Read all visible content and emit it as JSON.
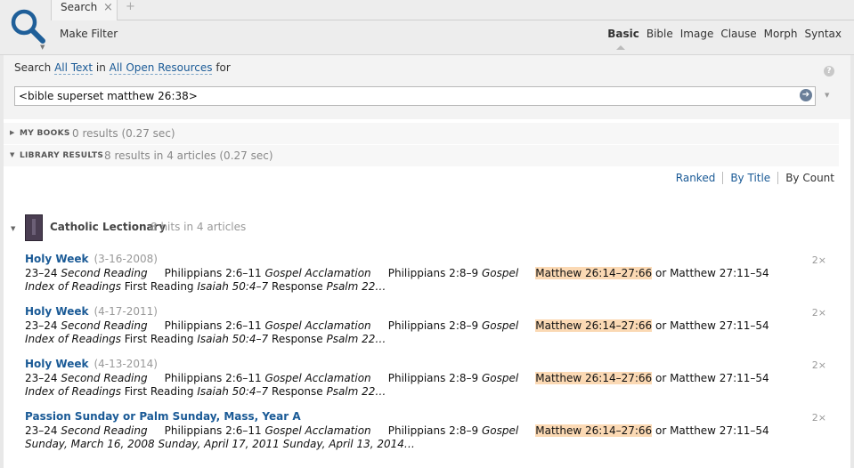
{
  "tab": {
    "label": "Search",
    "close": "×",
    "add": "+"
  },
  "toolbar": {
    "make_filter": "Make Filter"
  },
  "modes": [
    "Basic",
    "Bible",
    "Image",
    "Clause",
    "Morph",
    "Syntax"
  ],
  "search": {
    "prefix": "Search",
    "scope": "All Text",
    "in": "in",
    "resources": "All Open Resources",
    "for": "for",
    "query": "<bible superset matthew 26:38>"
  },
  "groups": [
    {
      "name": "MY BOOKS",
      "count": "0 results (0.27 sec)"
    },
    {
      "name": "LIBRARY RESULTS",
      "count": "8 results in 4 articles (0.27 sec)"
    }
  ],
  "sort": {
    "ranked": "Ranked",
    "by_title": "By Title",
    "by_count": "By Count"
  },
  "resource": {
    "title": "Catholic Lectionary",
    "hits": "8 hits in 4 articles"
  },
  "hits": [
    {
      "title": "Holy Week",
      "date": "(3-16-2008)",
      "count": "2×",
      "pre": "23–24 ",
      "sr": "Second Reading",
      "a": "     Philippians 2:6–11 ",
      "ga": "Gospel Acclamation",
      "b": "     Philippians 2:8–9 ",
      "g": "Gospel",
      "c": "     ",
      "hl": "Matthew 26:14–27:66",
      "d": " or Matthew 27:11–54 ",
      "tail_i": "Index of Readings",
      "tail": " First Reading ",
      "tail2_i": "Isaiah 50:4–7",
      "tail3": " Response ",
      "tail4_i": "Psalm 22…"
    },
    {
      "title": "Holy Week",
      "date": "(4-17-2011)",
      "count": "2×",
      "pre": "23–24 ",
      "sr": "Second Reading",
      "a": "     Philippians 2:6–11 ",
      "ga": "Gospel Acclamation",
      "b": "     Philippians 2:8–9 ",
      "g": "Gospel",
      "c": "     ",
      "hl": "Matthew 26:14–27:66",
      "d": " or Matthew 27:11–54 ",
      "tail_i": "Index of Readings",
      "tail": " First Reading ",
      "tail2_i": "Isaiah 50:4–7",
      "tail3": " Response ",
      "tail4_i": "Psalm 22…"
    },
    {
      "title": "Holy Week",
      "date": "(4-13-2014)",
      "count": "2×",
      "pre": "23–24 ",
      "sr": "Second Reading",
      "a": "     Philippians 2:6–11 ",
      "ga": "Gospel Acclamation",
      "b": "     Philippians 2:8–9 ",
      "g": "Gospel",
      "c": "     ",
      "hl": "Matthew 26:14–27:66",
      "d": " or Matthew 27:11–54 ",
      "tail_i": "Index of Readings",
      "tail": " First Reading ",
      "tail2_i": "Isaiah 50:4–7",
      "tail3": " Response ",
      "tail4_i": "Psalm 22…"
    },
    {
      "title": "Passion Sunday or Palm Sunday, Mass, Year A",
      "date": "",
      "count": "2×",
      "pre": "23–24 ",
      "sr": "Second Reading",
      "a": "     Philippians 2:6–11 ",
      "ga": "Gospel Acclamation",
      "b": "     Philippians 2:8–9 ",
      "g": "Gospel",
      "c": "     ",
      "hl": "Matthew 26:14–27:66",
      "d": " or Matthew 27:11–54 ",
      "tail_i": "Sunday, March 16, 2008 Sunday, April 17, 2011 Sunday, April 13, 2014…",
      "tail": "",
      "tail2_i": "",
      "tail3": "",
      "tail4_i": ""
    }
  ]
}
